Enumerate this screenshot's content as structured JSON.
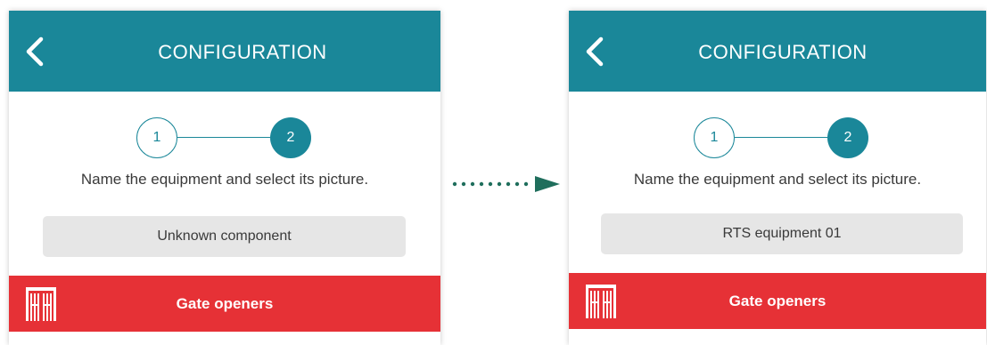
{
  "colors": {
    "header_bg": "#1a8799",
    "accent_teal": "#1a8799",
    "category_bar_bg": "#e63136",
    "field_bg": "#e6e6e6",
    "arrow": "#1f6e5c"
  },
  "before": {
    "header": {
      "title": "CONFIGURATION",
      "back_icon": "chevron-left-icon"
    },
    "stepper": {
      "step1": "1",
      "step2": "2",
      "current_step": 2
    },
    "instruction": "Name the equipment and select its picture.",
    "name_field": {
      "value": "Unknown component"
    },
    "category": {
      "label": "Gate openers",
      "icon": "gate-opener-icon"
    }
  },
  "after": {
    "header": {
      "title": "CONFIGURATION",
      "back_icon": "chevron-left-icon"
    },
    "stepper": {
      "step1": "1",
      "step2": "2",
      "current_step": 2
    },
    "instruction": "Name the equipment and select its picture.",
    "name_field": {
      "value": "RTS equipment 01"
    },
    "category": {
      "label": "Gate openers",
      "icon": "gate-opener-icon"
    }
  },
  "transition": {
    "icon": "dotted-arrow-right-icon"
  }
}
